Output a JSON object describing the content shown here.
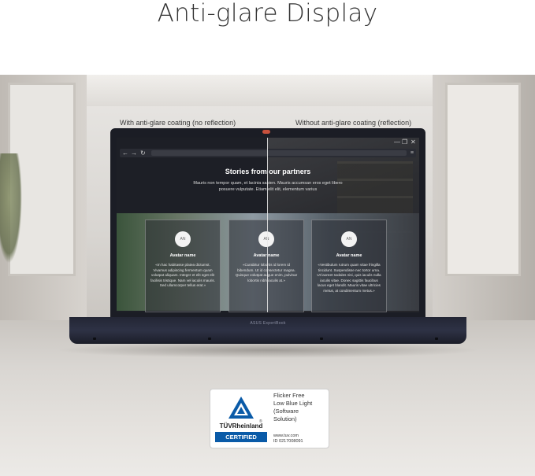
{
  "headline": "Anti-glare Display",
  "captions": {
    "left": "With anti-glare coating (no reflection)",
    "right": "Without anti-glare coating (reflection)"
  },
  "screen": {
    "window_controls": [
      "—",
      "❐",
      "✕"
    ],
    "nav_icons": [
      "←",
      "→",
      "↻"
    ],
    "menu_icon": "≡",
    "section_title": "Stories from our partners",
    "section_text": "Mauris non tempor quam, et lacinia sapien. Mauris accumsan eros eget libero posuere vulputate. Etiam elit elit, elementum varius",
    "cards": [
      {
        "initials": "AN",
        "name": "Avatar name",
        "text": "«In hac habitasse platea dictumst. Vivamus adipiscing fermentum quam volutpat aliquam. Integer et elit eget elit facilisis tristique. Nam vel iaculis mauris. Sed ullamcorper tellus erat.»"
      },
      {
        "initials": "AN",
        "name": "Avatar name",
        "text": "«Curabitur lobortis id lorem id bibendum. Ut id consectetur magna. Quisque volutpat augue enim, pulvinar lobortis nibh iaculis at.»"
      },
      {
        "initials": "AN",
        "name": "Avatar name",
        "text": "«Vestibulum rutrum quam vitae fringilla tincidunt. Suspendisse nec tortor urna. Ut laoreet sodales nisi, quis iaculis nulla iaculis vitae. Donec sagittis faucibus lacus eget blandit. Mauris vitae ultricies metus, at condimentum metus.»"
      }
    ]
  },
  "laptop_brand": "ASUS ExpertBook",
  "certification": {
    "logo_name": "TÜVRheinland",
    "registered_mark": "®",
    "certified_label": "CERTIFIED",
    "features": [
      "Flicker Free",
      "Low Blue Light",
      "(Software",
      "Solution)"
    ],
    "url": "www.tuv.com",
    "id_text": "ID 0217008091"
  },
  "colors": {
    "tuv_blue": "#0a5ba8",
    "laptop_body": "#232634",
    "camera_indicator": "#c8513d"
  }
}
